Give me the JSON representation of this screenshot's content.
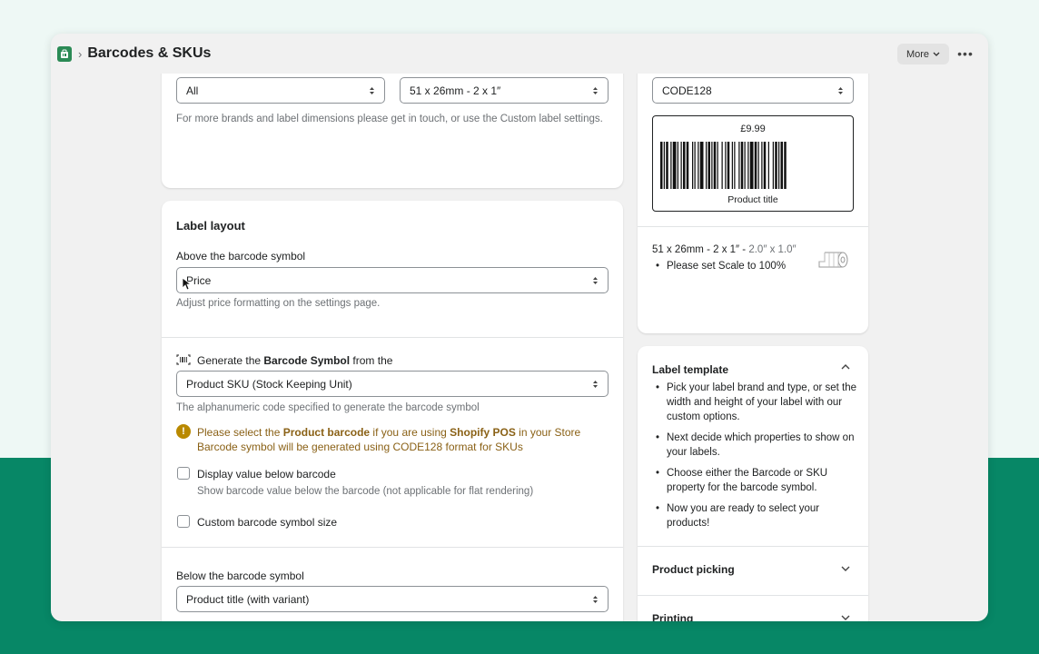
{
  "app": {
    "title": "Barcodes & SKUs",
    "more_label": "More"
  },
  "top_card": {
    "brand_value": "All",
    "size_value": "51 x 26mm - 2 x 1″",
    "help": "For more brands and label dimensions please get in touch, or use the Custom label settings."
  },
  "label_layout": {
    "title": "Label layout",
    "above_label": "Above the barcode symbol",
    "above_value": "Price",
    "above_help": "Adjust price formatting on the settings page.",
    "generate_prefix": "Generate the ",
    "generate_bold": "Barcode Symbol",
    "generate_suffix": " from the",
    "symbol_value": "Product SKU (Stock Keeping Unit)",
    "symbol_help": "The alphanumeric code specified to generate the barcode symbol",
    "warn_1": "Please select the ",
    "warn_bold_1": "Product barcode",
    "warn_2": " if you are using ",
    "warn_bold_2": "Shopify POS",
    "warn_3": " in your Store",
    "warn_line2": "Barcode symbol will be generated using CODE128 format for SKUs",
    "display_value_label": "Display value below barcode",
    "display_value_help": "Show barcode value below the barcode (not applicable for flat rendering)",
    "custom_size_label": "Custom barcode symbol size",
    "below_label": "Below the barcode symbol",
    "below_value": "Product title (with variant)"
  },
  "preview": {
    "format_value": "CODE128",
    "price": "£9.99",
    "product_title": "Product title",
    "size_text": "51 x 26mm - 2 x 1″ - ",
    "size_inches": "2.0″ x 1.0″",
    "scale_note": "Please set Scale to 100%"
  },
  "template": {
    "title": "Label template",
    "items": [
      "Pick your label brand and type, or set the width and height of your label with our custom options.",
      "Next decide which properties to show on your labels.",
      "Choose either the Barcode or SKU property for the barcode symbol.",
      "Now you are ready to select your products!"
    ],
    "product_picking": "Product picking",
    "printing": "Printing"
  },
  "colors": {
    "background_top": "#eef8f5",
    "background_bottom": "#078766",
    "app_icon": "#2b8a55",
    "warning": "#8a6116"
  }
}
